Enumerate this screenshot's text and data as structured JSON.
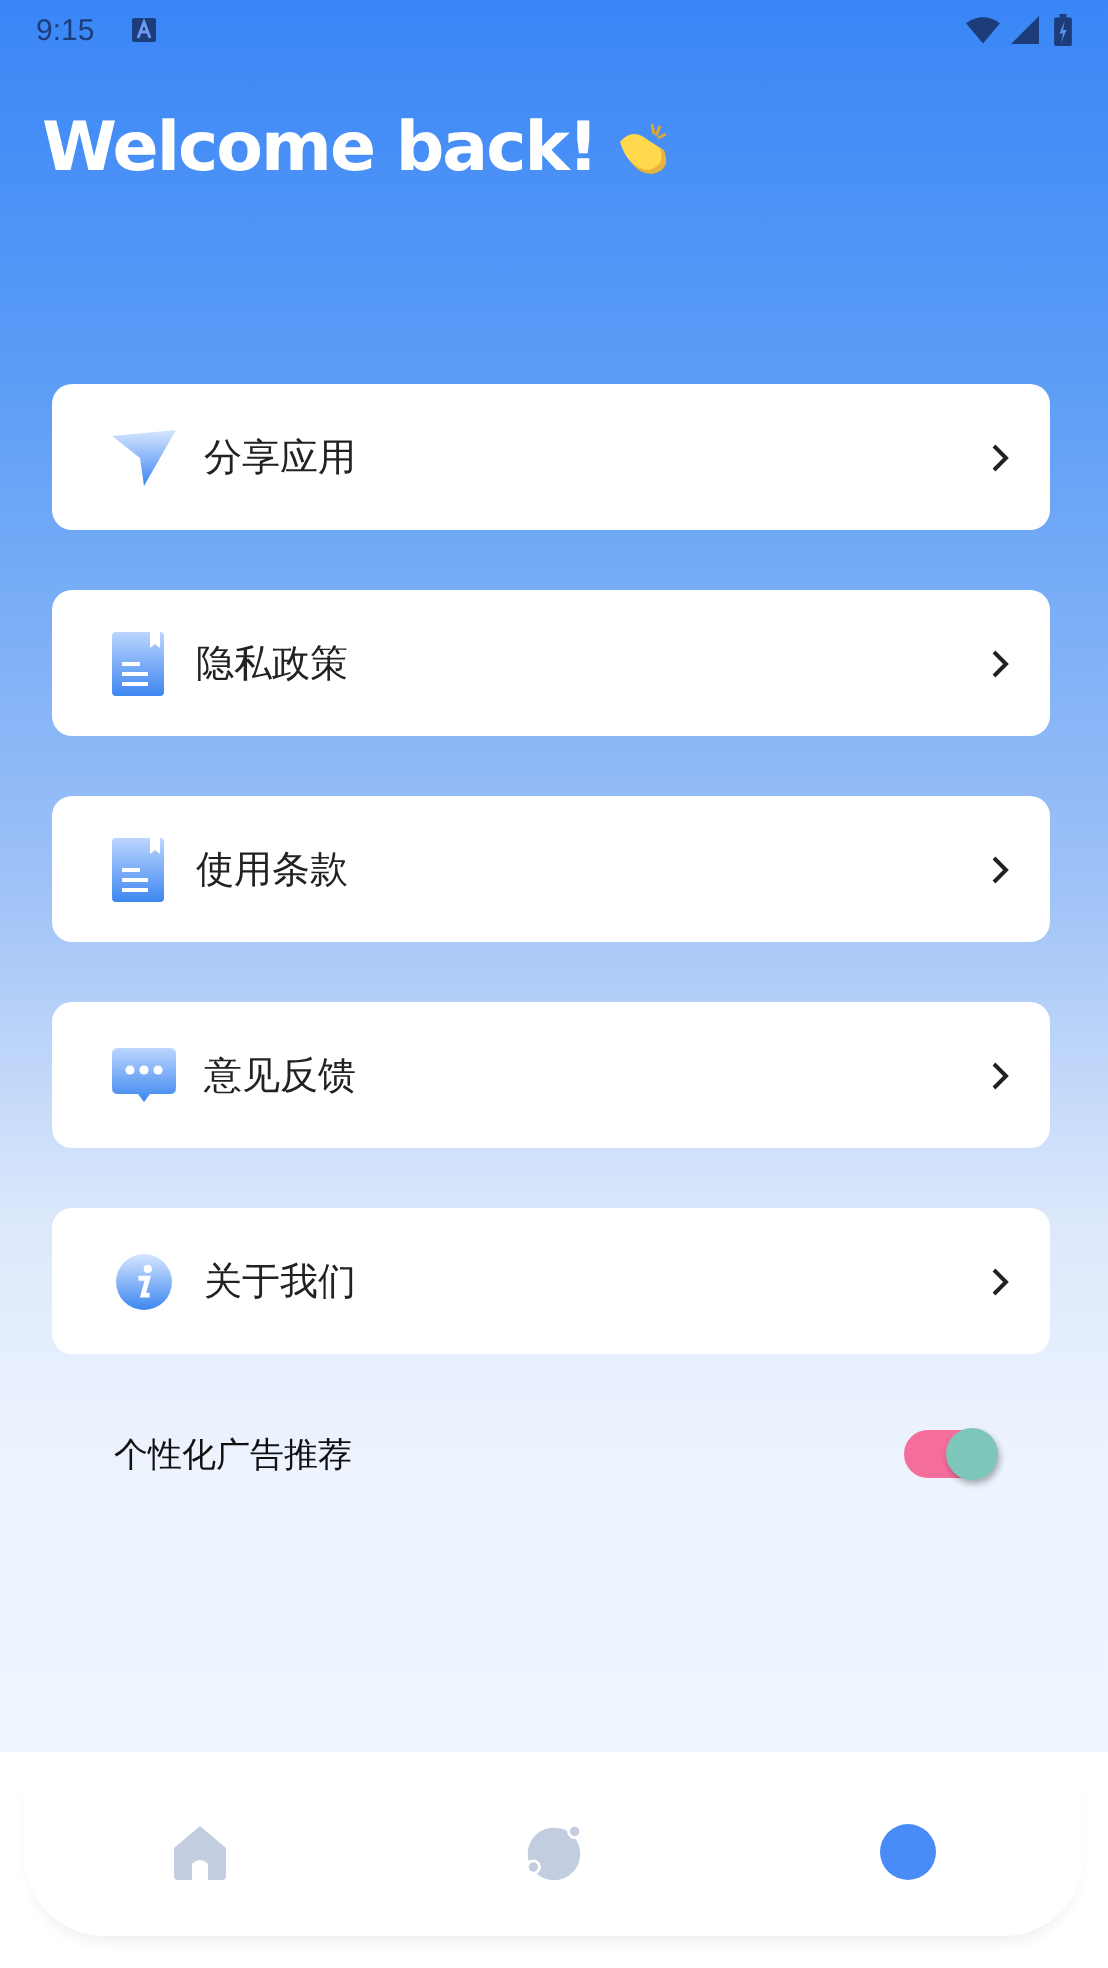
{
  "status_bar": {
    "time": "9:15"
  },
  "title": "Welcome back!",
  "menu": [
    {
      "kind": "share",
      "label": "分享应用"
    },
    {
      "kind": "document",
      "label": "隐私政策"
    },
    {
      "kind": "document",
      "label": "使用条款"
    },
    {
      "kind": "chat",
      "label": "意见反馈"
    },
    {
      "kind": "info",
      "label": "关于我们"
    }
  ],
  "setting": {
    "label": "个性化广告推荐",
    "on": true
  },
  "nav": [
    {
      "kind": "home",
      "selected": false
    },
    {
      "kind": "planet",
      "selected": false
    },
    {
      "kind": "profile",
      "selected": true
    }
  ]
}
